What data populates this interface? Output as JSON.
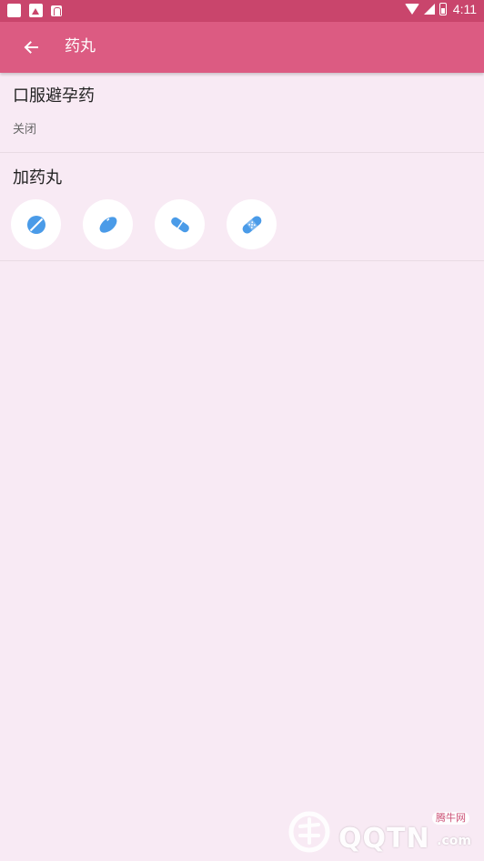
{
  "status_bar": {
    "time": "4:11"
  },
  "toolbar": {
    "title": "药丸",
    "back_icon": "arrow-back-icon"
  },
  "oral_contraceptive": {
    "title": "口服避孕药",
    "state": "关闭"
  },
  "add_pill": {
    "title": "加药丸",
    "options": [
      {
        "icon": "round-tablet-icon"
      },
      {
        "icon": "oval-tablet-icon"
      },
      {
        "icon": "capsule-icon"
      },
      {
        "icon": "patch-icon"
      }
    ]
  },
  "watermark": {
    "brand": "QQTN",
    "suffix": ".com",
    "badge": "腾牛网"
  },
  "colors": {
    "status_bar": "#c9456c",
    "toolbar": "#dc5b82",
    "background": "#f8eaf4",
    "icon_blue": "#4a9be8"
  }
}
